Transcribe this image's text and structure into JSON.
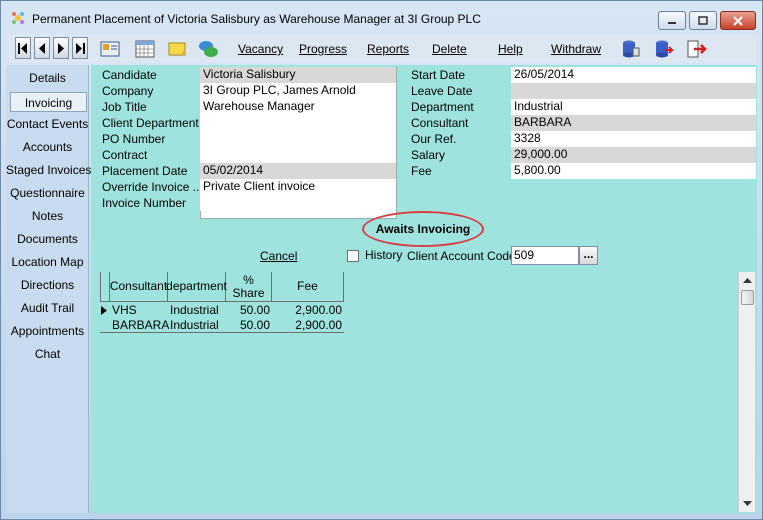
{
  "window": {
    "title": "Permanent Placement of Victoria Salisbury as Warehouse Manager at 3I Group PLC"
  },
  "toolbar": {
    "links": [
      "Vacancy",
      "Progress",
      "Reports",
      "Delete",
      "Help",
      "Withdraw"
    ]
  },
  "sidebar": {
    "items": [
      "Details",
      "Invoicing",
      "Contact Events",
      "Accounts",
      "Staged Invoices",
      "Questionnaire",
      "Notes",
      "Documents",
      "Location Map",
      "Directions",
      "Audit Trail",
      "Appointments",
      "Chat"
    ],
    "active": "Invoicing"
  },
  "left_fields": [
    {
      "label": "Candidate",
      "value": "Victoria Salisbury"
    },
    {
      "label": "Company",
      "value": "3I Group PLC, James Arnold"
    },
    {
      "label": "Job Title",
      "value": "Warehouse Manager"
    },
    {
      "label": "Client Department",
      "value": ""
    },
    {
      "label": "PO Number",
      "value": ""
    },
    {
      "label": "Contract",
      "value": ""
    },
    {
      "label": "Placement Date",
      "value": "05/02/2014"
    },
    {
      "label": "Override Invoice ...",
      "value": "Private Client invoice"
    },
    {
      "label": "Invoice Number",
      "value": ""
    }
  ],
  "right_fields": [
    {
      "label": "Start Date",
      "value": "26/05/2014"
    },
    {
      "label": "Leave Date",
      "value": ""
    },
    {
      "label": "Department",
      "value": "Industrial"
    },
    {
      "label": "Consultant",
      "value": "BARBARA"
    },
    {
      "label": "Our Ref.",
      "value": "3328"
    },
    {
      "label": "Salary",
      "value": "29,000.00"
    },
    {
      "label": "Fee",
      "value": "5,800.00"
    }
  ],
  "status": "Awaits Invoicing",
  "cancel_label": "Cancel",
  "history_label": "History",
  "client_account_code": {
    "label": "Client Account Code",
    "value": "509",
    "button": "..."
  },
  "table": {
    "headers": [
      "Consultant",
      "department",
      "%\nShare",
      "Fee"
    ],
    "rows": [
      [
        "VHS",
        "Industrial",
        "50.00",
        "2,900.00"
      ],
      [
        "BARBARA",
        "Industrial",
        "50.00",
        "2,900.00"
      ]
    ]
  },
  "colors": {
    "main_bg": "#9fe3df",
    "highlight": "#d84040"
  }
}
